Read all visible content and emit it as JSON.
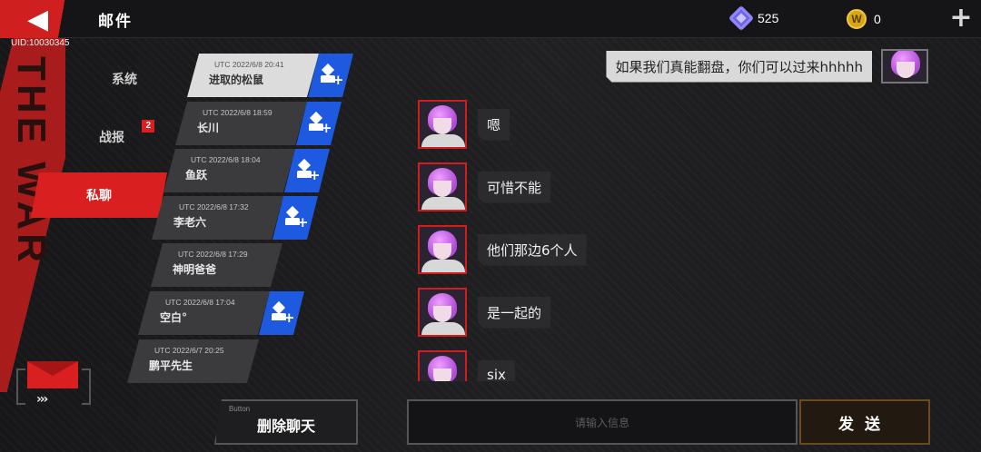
{
  "header": {
    "back_icon": "back-arrow-icon",
    "title": "邮件",
    "uid": "UID:10030345",
    "resources": [
      {
        "icon": "gem-icon",
        "value": "525"
      },
      {
        "icon": "coin-icon",
        "icon_letter": "W",
        "value": "0"
      }
    ],
    "add_icon": "plus-icon"
  },
  "categories": [
    {
      "label": "系统",
      "badge": ""
    },
    {
      "label": "战报",
      "badge": "2"
    },
    {
      "label": "私聊",
      "badge": "",
      "active": true
    }
  ],
  "contacts": [
    {
      "time": "UTC 2022/6/8 20:41",
      "name": "进取的松鼠",
      "can_add": true,
      "active": true
    },
    {
      "time": "UTC 2022/6/8 18:59",
      "name": "长川",
      "can_add": true
    },
    {
      "time": "UTC 2022/6/8 18:04",
      "name": "鱼跃",
      "can_add": true
    },
    {
      "time": "UTC 2022/6/8 17:32",
      "name": "李老六",
      "can_add": true
    },
    {
      "time": "UTC 2022/6/8 17:29",
      "name": "神明爸爸",
      "can_add": false
    },
    {
      "time": "UTC 2022/6/8 17:04",
      "name": "空白°",
      "can_add": true
    },
    {
      "time": "UTC 2022/6/7 20:25",
      "name": "鹏平先生",
      "can_add": false
    }
  ],
  "messages": [
    {
      "from": "me",
      "text": "如果我们真能翻盘，你们可以过来hhhhh"
    },
    {
      "from": "other",
      "text": "嗯"
    },
    {
      "from": "other",
      "text": "可惜不能"
    },
    {
      "from": "other",
      "text": "他们那边6个人"
    },
    {
      "from": "other",
      "text": "是一起的"
    },
    {
      "from": "other",
      "text": "six"
    }
  ],
  "footer": {
    "delete_tiny": "Button",
    "delete_label": "删除聊天",
    "input_placeholder": "请输入信息",
    "send_label": "发送"
  },
  "colors": {
    "accent_red": "#d91f1f",
    "add_blue": "#1d5ae0",
    "background": "#1b1b1d"
  }
}
